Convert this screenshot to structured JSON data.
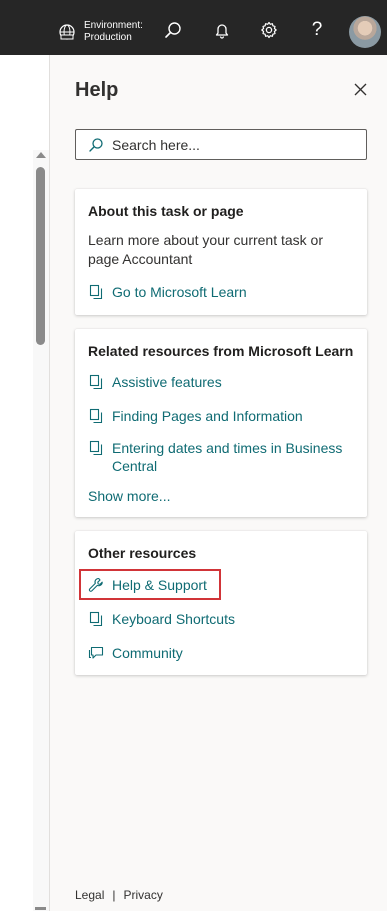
{
  "topbar": {
    "environment_label": "Environment:",
    "environment_value": "Production",
    "icons": [
      "environment-icon",
      "search-icon",
      "bell-icon",
      "gear-icon",
      "help-icon",
      "avatar"
    ],
    "help_glyph": "?"
  },
  "pane": {
    "title": "Help",
    "search_placeholder": "Search here...",
    "sections": {
      "about": {
        "title": "About this task or page",
        "description": "Learn more about your current task or page Accountant",
        "link": "Go to Microsoft Learn"
      },
      "related": {
        "title": "Related resources from Microsoft Learn",
        "links": [
          "Assistive features",
          "Finding Pages and Information",
          "Entering dates and times in Business Central"
        ],
        "show_more": "Show more..."
      },
      "other": {
        "title": "Other resources",
        "links": [
          "Help & Support",
          "Keyboard Shortcuts",
          "Community"
        ]
      }
    },
    "footer": {
      "legal": "Legal",
      "separator": "|",
      "privacy": "Privacy"
    }
  },
  "colors": {
    "topbar_bg": "#262626",
    "link": "#0f6b73",
    "highlight": "#d13438",
    "pane_bg": "#faf9f8"
  }
}
